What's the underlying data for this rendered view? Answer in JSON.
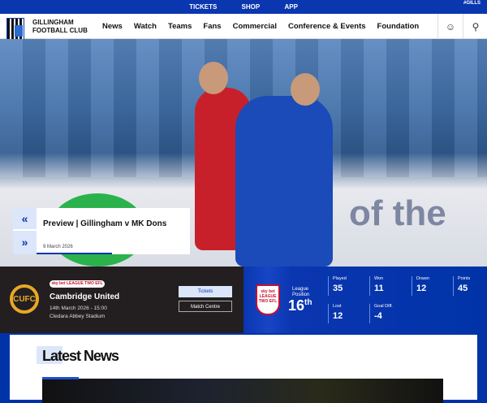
{
  "topbar": {
    "links": [
      "TICKETS",
      "SHOP",
      "APP"
    ],
    "hashtag": "#GILLS"
  },
  "nav": {
    "club_line1": "GILLINGHAM",
    "club_line2": "FOOTBALL CLUB",
    "items": [
      "News",
      "Watch",
      "Teams",
      "Fans",
      "Commercial",
      "Conference & Events",
      "Foundation"
    ],
    "account_icon": "person-icon",
    "search_icon": "search-icon"
  },
  "hero": {
    "prev_icon": "«",
    "next_icon": "»",
    "title": "Preview | Gillingham v MK Dons",
    "date": "9 March 2026",
    "board_text": "of the"
  },
  "fixture": {
    "competition": "sky bet LEAGUE TWO EFL",
    "opponent_logo": "CUFC",
    "opponent": "Cambridge United",
    "datetime": "14th March 2026 - 15:00",
    "venue": "Cledara Abbey Stadium",
    "tickets": "Tickets",
    "match_centre": "Match Centre"
  },
  "table": {
    "badge": "sky bet LEAGUE TWO EFL",
    "position_label_1": "League",
    "position_label_2": "Position",
    "position": "16",
    "position_suffix": "th",
    "stats": [
      {
        "label": "Played",
        "value": "35"
      },
      {
        "label": "Won",
        "value": "11"
      },
      {
        "label": "Drawn",
        "value": "12"
      },
      {
        "label": "Points",
        "value": "45"
      },
      {
        "label": "Lost",
        "value": "12"
      },
      {
        "label": "Goal Diff.",
        "value": "-4"
      }
    ]
  },
  "news": {
    "heading": "Latest News"
  },
  "colors": {
    "primary": "#0a36b0",
    "light": "#dbe6fb",
    "dark": "#231f20",
    "accent": "#e9a827"
  }
}
